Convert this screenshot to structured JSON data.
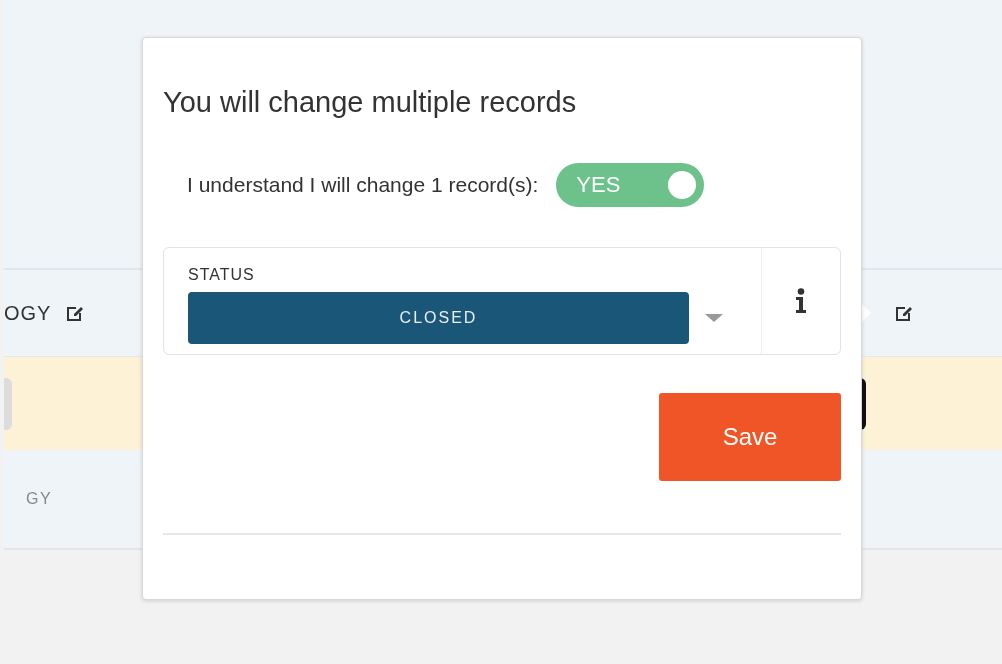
{
  "background_table": {
    "header_cell": "OGY",
    "row_cell": "GY"
  },
  "popover": {
    "title": "You will change multiple records",
    "confirm": {
      "label": "I understand I will change 1 record(s):",
      "toggle": {
        "on": true,
        "text": "YES"
      }
    },
    "field": {
      "label": "STATUS",
      "value": "CLOSED"
    },
    "save_button": "Save"
  }
}
